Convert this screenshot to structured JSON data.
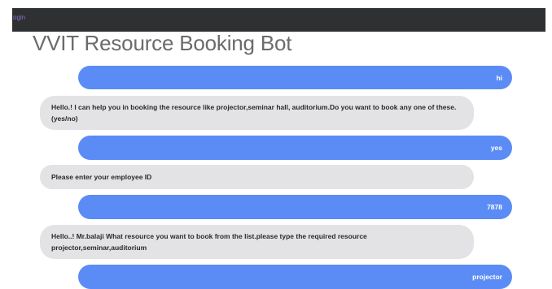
{
  "topbar": {
    "login_label": "ogin"
  },
  "page_title": "VVIT Resource Booking Bot",
  "messages": [
    {
      "from": "user",
      "text": "hi"
    },
    {
      "from": "bot",
      "text": "Hello.! I can help you in booking the resource like projector,seminar hall, auditorium.Do you want to book any one of these.(yes/no)"
    },
    {
      "from": "user",
      "text": "yes"
    },
    {
      "from": "bot",
      "text": "Please enter your employee ID"
    },
    {
      "from": "user",
      "text": "7878"
    },
    {
      "from": "bot",
      "text": "Hello..! Mr.balaji What resource you want to book from the list.please type the required resource projector,seminar,auditorium"
    },
    {
      "from": "user",
      "text": "projector"
    }
  ],
  "colors": {
    "user_bubble": "#5b8cf5",
    "bot_bubble": "#e3e3e6",
    "topbar": "#2f3032"
  }
}
